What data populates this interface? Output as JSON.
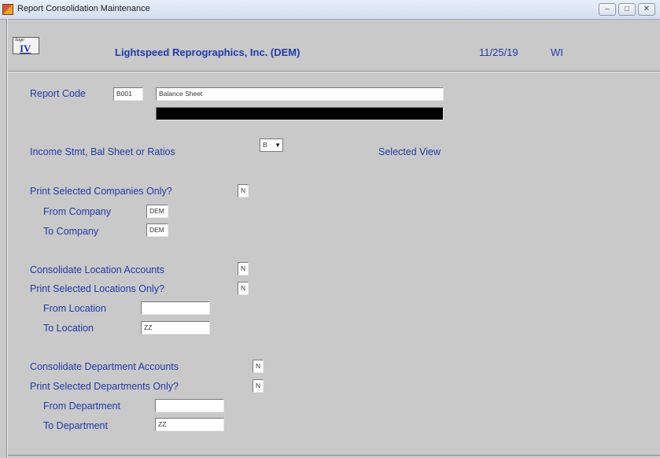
{
  "window": {
    "title": "Report Consolidation Maintenance",
    "controls": {
      "minimize": "–",
      "maximize": "□",
      "close": "✕"
    }
  },
  "header": {
    "logo_small": "Sage",
    "logo_big": "IV",
    "company": "Lightspeed Reprographics, Inc. (DEM)",
    "date": "11/25/19",
    "user": "WI"
  },
  "form": {
    "report_code_label": "Report Code",
    "report_code_value": "B001",
    "report_description": "Balance Sheet",
    "report_description_2": "",
    "type_label": "Income Stmt, Bal Sheet or Ratios",
    "type_value": "B",
    "selected_view_label": "Selected View",
    "print_selected_companies_label": "Print Selected Companies Only?",
    "print_selected_companies_value": "N",
    "from_company_label": "From Company",
    "from_company_value": "DEM",
    "to_company_label": "To Company",
    "to_company_value": "DEM",
    "consolidate_location_label": "Consolidate Location Accounts",
    "consolidate_location_value": "N",
    "print_selected_locations_label": "Print Selected Locations Only?",
    "print_selected_locations_value": "N",
    "from_location_label": "From Location",
    "from_location_value": "",
    "to_location_label": "To Location",
    "to_location_value": "ZZ",
    "consolidate_department_label": "Consolidate Department Accounts",
    "consolidate_department_value": "N",
    "print_selected_departments_label": "Print Selected Departments Only?",
    "print_selected_departments_value": "N",
    "from_department_label": "From Department",
    "from_department_value": "",
    "to_department_label": "To Department",
    "to_department_value": "ZZ"
  },
  "colors": {
    "label_blue": "#1f3aa8",
    "background": "#c9c9c9"
  }
}
